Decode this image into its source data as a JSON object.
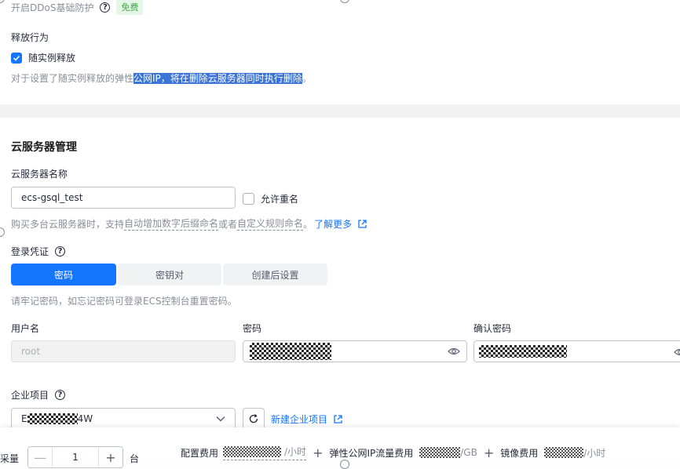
{
  "ddos": {
    "label": "开启DDoS基础防护",
    "badge": "免费"
  },
  "release": {
    "title": "释放行为",
    "checkbox_label": "随实例释放",
    "checked": true,
    "hint_prefix": "对于设置了随实例释放的弹性",
    "hint_highlight": "公网IP，将在删除云服务器同时执行删除",
    "hint_suffix": "。"
  },
  "server_mgmt": {
    "section_title": "云服务器管理",
    "name_label": "云服务器名称",
    "name_value": "ecs-gsql_test",
    "allow_duplicate_label": "允许重名",
    "allow_duplicate_checked": false,
    "name_hint_1": "购买多台云服务器时，支持",
    "name_hint_link1": "自动增加数字后缀命名",
    "name_hint_2": "或者",
    "name_hint_link2": "自定义规则命名",
    "name_hint_3": "。",
    "learn_more": "了解更多"
  },
  "login": {
    "title": "登录凭证",
    "tabs": [
      {
        "label": "密码",
        "active": true
      },
      {
        "label": "密钥对",
        "active": false
      },
      {
        "label": "创建后设置",
        "active": false
      }
    ],
    "hint": "请牢记密码，如忘记密码可登录ECS控制台重置密码。",
    "username_label": "用户名",
    "username_value": "root",
    "password_label": "密码",
    "confirm_label": "确认密码"
  },
  "enterprise": {
    "title": "企业项目",
    "select_prefix": "E",
    "select_suffix": "4W",
    "new_link": "新建企业项目"
  },
  "footer": {
    "quantity_label": "采量",
    "quantity_value": "1",
    "quantity_unit": "台",
    "config_fee_label": "配置费用",
    "config_fee_unit": "/小时",
    "plus": "+",
    "eip_fee_label": "弹性公网IP流量费用",
    "eip_fee_unit": "/GB",
    "image_fee_label": "镜像费用",
    "image_fee_unit": "/小时"
  },
  "colors": {
    "accent": "#1476ff",
    "free_badge_bg": "#e5f6e6",
    "free_badge_text": "#3fa548",
    "selection_highlight": "#3b73d6"
  }
}
